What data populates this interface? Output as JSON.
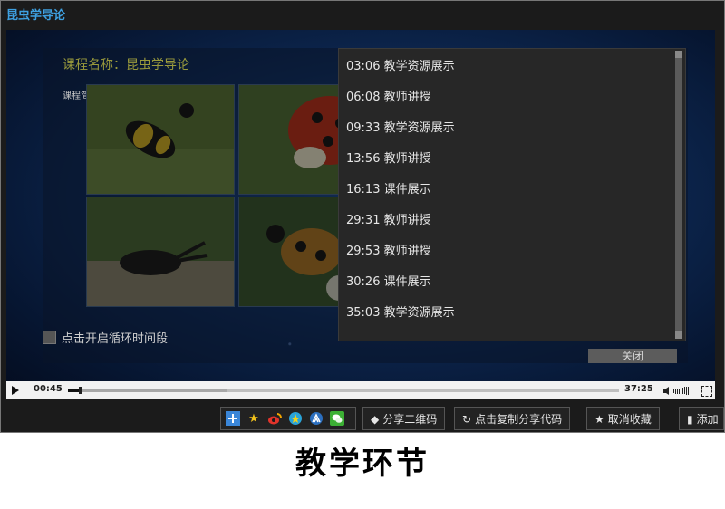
{
  "window": {
    "title": "昆虫学导论"
  },
  "course": {
    "name_label": "课程名称：昆虫学导论",
    "intro_label": "课程简介："
  },
  "images": [
    {
      "subject": "black-and-yellow beetle"
    },
    {
      "subject": "ladybug"
    },
    {
      "subject": "stag beetle"
    },
    {
      "subject": "spotted beetle"
    }
  ],
  "chapters": [
    {
      "time": "03:06",
      "label": "教学资源展示"
    },
    {
      "time": "06:08",
      "label": "教师讲授"
    },
    {
      "time": "09:33",
      "label": "教学资源展示"
    },
    {
      "time": "13:56",
      "label": "教师讲授"
    },
    {
      "time": "16:13",
      "label": "课件展示"
    },
    {
      "time": "29:31",
      "label": "教师讲授"
    },
    {
      "time": "29:53",
      "label": "教师讲授"
    },
    {
      "time": "30:26",
      "label": "课件展示"
    },
    {
      "time": "35:03",
      "label": "教学资源展示"
    }
  ],
  "loop_label": "点击开启循环时间段",
  "close_label": "关闭",
  "player": {
    "current_time": "00:45",
    "duration": "37:25",
    "progress": 0.02,
    "buffered": 0.29
  },
  "toolbar": {
    "share_icons": [
      "add-icon",
      "star-icon",
      "weibo-icon",
      "qzone-icon",
      "renren-icon",
      "wechat-icon"
    ],
    "qr_label": "分享二维码",
    "copy_label": "点击复制分享代码",
    "unfav_label": "取消收藏",
    "add_label": "添加"
  },
  "caption": "教学环节"
}
